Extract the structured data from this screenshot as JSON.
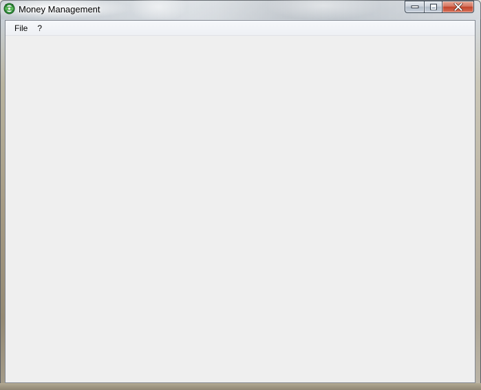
{
  "window": {
    "title": "Money Management",
    "icon": "money-management-app-icon"
  },
  "caption_buttons": {
    "minimize_icon": "minimize-icon",
    "maximize_icon": "maximize-icon",
    "close_icon": "close-icon",
    "close_color": "#c2442a"
  },
  "menubar": {
    "items": [
      {
        "label": "File"
      },
      {
        "label": "?"
      }
    ]
  },
  "colors": {
    "client_background": "#efefef",
    "menubar_background": "#f6f8fb"
  }
}
